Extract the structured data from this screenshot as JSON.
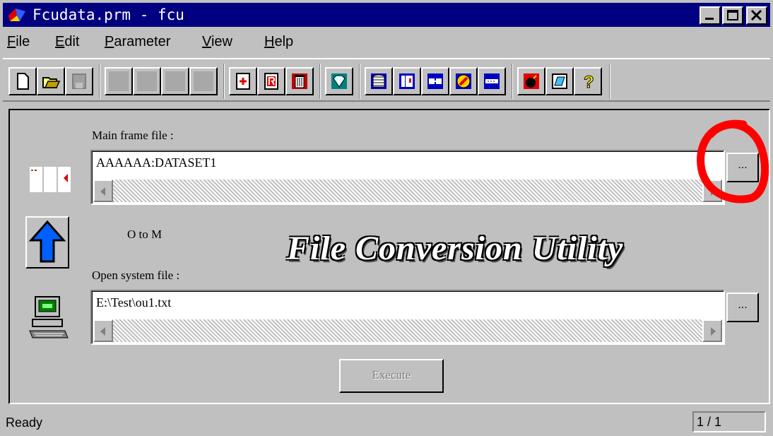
{
  "window": {
    "title": "Fcudata.prm - fcu"
  },
  "menu": [
    "File",
    "Edit",
    "Parameter",
    "View",
    "Help"
  ],
  "toolbar": {
    "buttons": [
      {
        "icon": "new-file-icon"
      },
      {
        "icon": "open-folder-icon"
      },
      {
        "icon": "save-icon"
      },
      {
        "icon": "disabled-1-icon"
      },
      {
        "icon": "disabled-2-icon"
      },
      {
        "icon": "disabled-3-icon"
      },
      {
        "icon": "disabled-4-icon"
      },
      {
        "icon": "add-record-icon"
      },
      {
        "icon": "r-record-icon"
      },
      {
        "icon": "delete-trash-icon"
      },
      {
        "icon": "diamond-icon"
      },
      {
        "icon": "stack-icon"
      },
      {
        "icon": "frame-icon"
      },
      {
        "icon": "connector-icon"
      },
      {
        "icon": "pencil-circle-icon"
      },
      {
        "icon": "ruler-icon"
      },
      {
        "icon": "bomb-icon"
      },
      {
        "icon": "edit-note-icon"
      },
      {
        "icon": "help-question-icon"
      }
    ]
  },
  "main": {
    "mainframe_label": "Main frame file :",
    "mainframe_value": "AAAAAA:DATASET1",
    "direction": "O to M",
    "banner": "File Conversion Utility",
    "open_label": "Open system file :",
    "open_value": "E:\\Test\\ou1.txt",
    "browse_label": "...",
    "execute_label": "Execute"
  },
  "statusbar": {
    "status": "Ready",
    "page": "1 / 1"
  },
  "colors": {
    "titlebar": "#000080",
    "face": "#c0c0c0",
    "annotation": "#ff0000"
  }
}
